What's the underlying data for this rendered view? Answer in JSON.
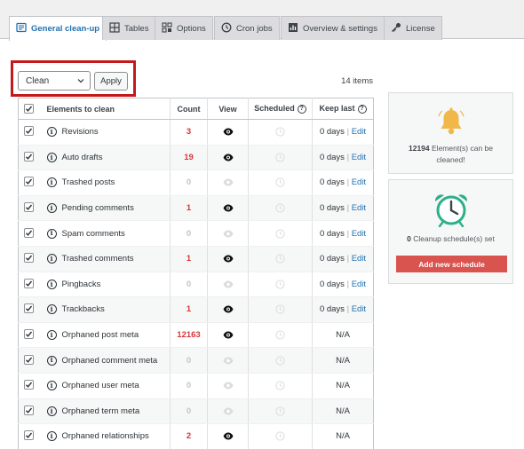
{
  "tabs": [
    {
      "label": "General clean-up",
      "icon": "broom-icon",
      "active": true
    },
    {
      "label": "Tables",
      "icon": "table-icon",
      "active": false
    },
    {
      "label": "Options",
      "icon": "options-icon",
      "active": false
    },
    {
      "label": "Cron jobs",
      "icon": "clock-icon",
      "active": false
    },
    {
      "label": "Overview & settings",
      "icon": "chart-icon",
      "active": false
    },
    {
      "label": "License",
      "icon": "key-icon",
      "active": false
    }
  ],
  "bulk_action": {
    "selected": "Clean",
    "apply_label": "Apply"
  },
  "items_count": "14 items",
  "table": {
    "headers": {
      "name": "Elements to clean",
      "count": "Count",
      "view": "View",
      "scheduled": "Scheduled",
      "keep_last": "Keep last"
    },
    "rows": [
      {
        "name": "Revisions",
        "count": "3",
        "viewable": true,
        "keep": "0 days",
        "edit": "Edit"
      },
      {
        "name": "Auto drafts",
        "count": "19",
        "viewable": true,
        "keep": "0 days",
        "edit": "Edit"
      },
      {
        "name": "Trashed posts",
        "count": "0",
        "viewable": false,
        "keep": "0 days",
        "edit": "Edit"
      },
      {
        "name": "Pending comments",
        "count": "1",
        "viewable": true,
        "keep": "0 days",
        "edit": "Edit"
      },
      {
        "name": "Spam comments",
        "count": "0",
        "viewable": false,
        "keep": "0 days",
        "edit": "Edit"
      },
      {
        "name": "Trashed comments",
        "count": "1",
        "viewable": true,
        "keep": "0 days",
        "edit": "Edit"
      },
      {
        "name": "Pingbacks",
        "count": "0",
        "viewable": false,
        "keep": "0 days",
        "edit": "Edit"
      },
      {
        "name": "Trackbacks",
        "count": "1",
        "viewable": true,
        "keep": "0 days",
        "edit": "Edit"
      },
      {
        "name": "Orphaned post meta",
        "count": "12163",
        "viewable": true,
        "keep": "N/A",
        "edit": ""
      },
      {
        "name": "Orphaned comment meta",
        "count": "0",
        "viewable": false,
        "keep": "N/A",
        "edit": ""
      },
      {
        "name": "Orphaned user meta",
        "count": "0",
        "viewable": false,
        "keep": "N/A",
        "edit": ""
      },
      {
        "name": "Orphaned term meta",
        "count": "0",
        "viewable": false,
        "keep": "N/A",
        "edit": ""
      },
      {
        "name": "Orphaned relationships",
        "count": "2",
        "viewable": true,
        "keep": "N/A",
        "edit": ""
      }
    ]
  },
  "sidebar": {
    "elements_count": "12194",
    "elements_text": "Element(s) can be",
    "elements_text2": "cleaned!",
    "schedules_count": "0",
    "schedules_text": "Cleanup schedule(s) set",
    "add_schedule_label": "Add new schedule"
  },
  "colors": {
    "accent": "#2271b1",
    "count_red": "#d63638",
    "bell": "#f0b849",
    "alarm": "#2fae8a",
    "button_red": "#d9534f",
    "highlight_border": "#c4191c"
  }
}
